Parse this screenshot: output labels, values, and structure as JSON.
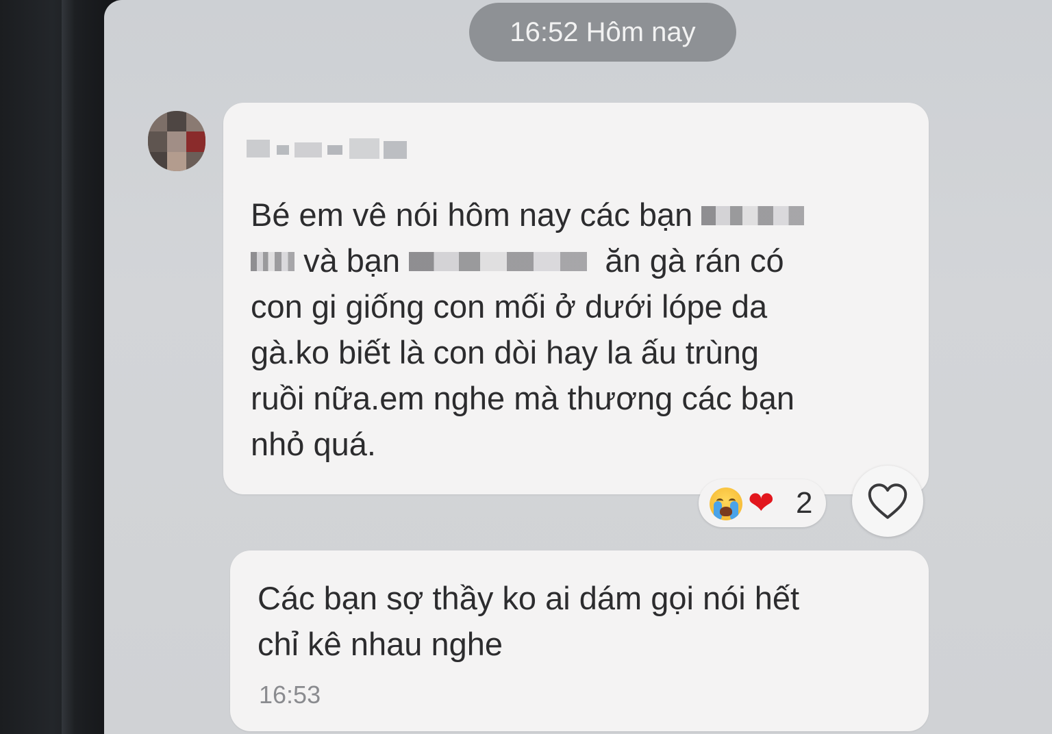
{
  "chat": {
    "date_separator": "16:52 Hôm nay",
    "messages": [
      {
        "lines": [
          "Bé em vê nói hôm nay các bạn",
          "và bạn",
          "ăn gà rán có",
          "con gi giống con mối ở dưới lópe da",
          "gà.ko biết là con dòi hay la ấu trùng",
          "ruồi nữa.em nghe mà thương các bạn",
          "nhỏ quá."
        ],
        "reactions": {
          "emojis": [
            "crying-face-icon",
            "red-heart-icon"
          ],
          "heart_glyph": "❤",
          "count": "2"
        }
      },
      {
        "lines": [
          "Các bạn sợ thầy ko ai dám gọi nói hết",
          "chỉ kê nhau nghe"
        ],
        "time": "16:53"
      }
    ]
  },
  "colors": {
    "screen_bg": "#d0d2d5",
    "bubble_bg": "#f4f3f3",
    "time_pill_bg": "#8e9195",
    "heart": "#e2161d"
  }
}
